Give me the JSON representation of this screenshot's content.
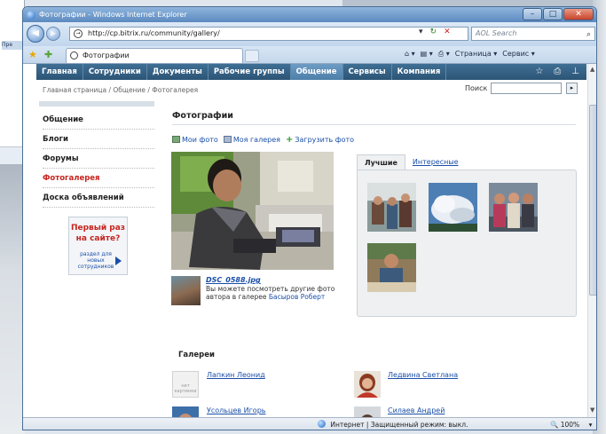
{
  "background": {
    "strip_text": "Пре"
  },
  "window": {
    "title": "Фотографии - Windows Internet Explorer",
    "controls": {
      "minimize": "–",
      "maximize": "□",
      "close": "✕"
    }
  },
  "address_bar": {
    "url": "http://cp.bitrix.ru/community/gallery/",
    "search_placeholder": "AOL Search",
    "buttons": {
      "dropdown": "▾",
      "refresh": "↻",
      "stop": "✕"
    }
  },
  "tab": {
    "label": "Фотографии"
  },
  "command_bar": {
    "page_label": "Страница ▾",
    "tools_label": "Сервис ▾"
  },
  "site_menu": {
    "items": [
      {
        "label": "Главная",
        "active": false
      },
      {
        "label": "Сотрудники",
        "active": false
      },
      {
        "label": "Документы",
        "active": false
      },
      {
        "label": "Рабочие группы",
        "active": false
      },
      {
        "label": "Общение",
        "active": true
      },
      {
        "label": "Сервисы",
        "active": false
      },
      {
        "label": "Компания",
        "active": false
      }
    ],
    "icons": [
      "star-icon",
      "print-icon",
      "sitemap-icon"
    ]
  },
  "breadcrumb": "Главная страница / Общение / Фотогалерея",
  "search": {
    "label": "Поиск",
    "button": "▸"
  },
  "left_nav": [
    {
      "label": "Общение",
      "current": false
    },
    {
      "label": "Блоги",
      "current": false
    },
    {
      "label": "Форумы",
      "current": false
    },
    {
      "label": "Фотогалерея",
      "current": true
    },
    {
      "label": "Доска объявлений",
      "current": false
    }
  ],
  "promo": {
    "title": "Первый раз на сайте?",
    "subtitle": "раздел для новых сотрудников"
  },
  "main": {
    "title": "Фотографии",
    "actions": {
      "my_photos": "Мои фото",
      "my_gallery": "Моя галерея",
      "upload": "Загрузить фото"
    },
    "photo": {
      "filename": "DSC_0588.jpg",
      "desc_prefix": "Вы можете посмотреть другие фото автора в галерее",
      "author_link": "Басыров Роберт"
    },
    "tabs": {
      "best": "Лучшие",
      "interesting": "Интересные"
    },
    "galleries_title": "Галереи",
    "galleries": [
      {
        "name": "Лапкин Леонид"
      },
      {
        "name": "Ледвина Светлана"
      },
      {
        "name": "Усольцев Игорь"
      },
      {
        "name": "Силаев Андрей"
      }
    ],
    "no_picture_label": "нет картинки"
  },
  "status_bar": {
    "text": "Интернет | Защищенный режим: выкл.",
    "zoom": "100%",
    "zoom_arrow": "▾"
  },
  "colors": {
    "menu_bar": "#2c5576",
    "link": "#1a4fa8",
    "current_nav": "#c8231e",
    "titlebar": "#5b89c0"
  }
}
